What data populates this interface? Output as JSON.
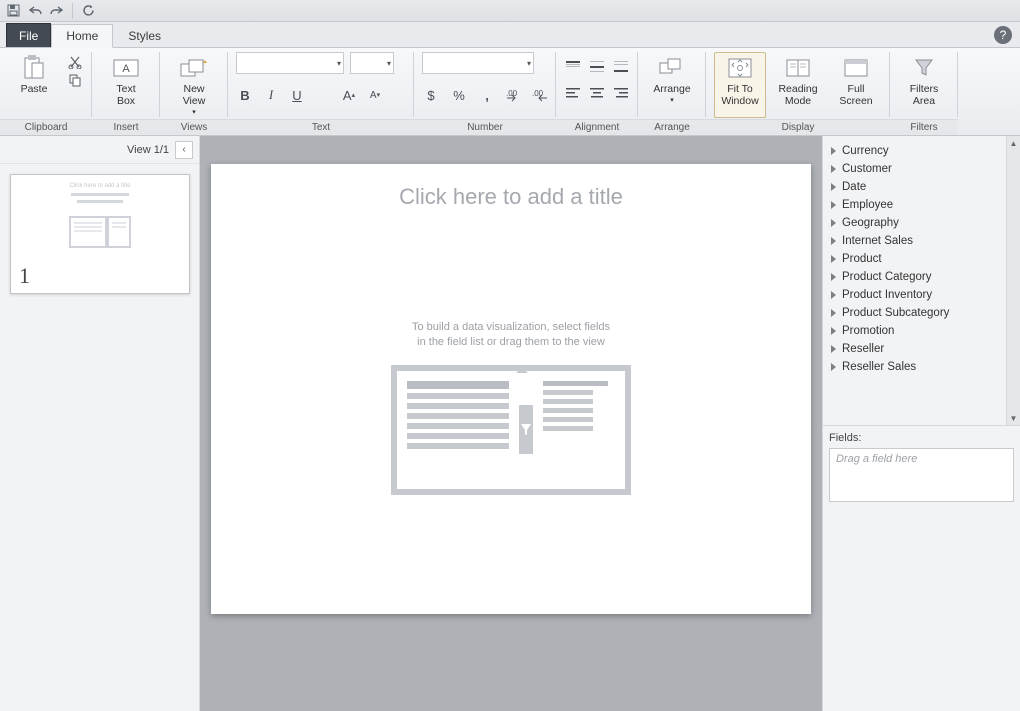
{
  "qat": {
    "save": "save-icon",
    "undo": "undo-icon",
    "redo": "redo-icon",
    "refresh": "refresh-icon"
  },
  "tabs": {
    "file": "File",
    "home": "Home",
    "styles": "Styles"
  },
  "ribbon": {
    "clipboard": {
      "paste": "Paste",
      "label": "Clipboard"
    },
    "insert": {
      "textbox": "Text\nBox",
      "newview": "New\nView",
      "label_insert": "Insert",
      "label_views": "Views"
    },
    "text": {
      "label": "Text"
    },
    "number": {
      "label": "Number"
    },
    "align": {
      "label": "Alignment"
    },
    "arrange": {
      "btn": "Arrange",
      "label": "Arrange"
    },
    "display": {
      "fit": "Fit To\nWindow",
      "reading": "Reading\nMode",
      "full": "Full\nScreen",
      "label": "Display"
    },
    "filters": {
      "btn": "Filters\nArea",
      "label": "Filters"
    }
  },
  "nav": {
    "view_label": "View 1/1",
    "page_number": "1"
  },
  "slide": {
    "title_placeholder": "Click here to add a title",
    "help_line1": "To build a data visualization, select fields",
    "help_line2": "in the field list or drag them to the view"
  },
  "fields": {
    "items": [
      "Currency",
      "Customer",
      "Date",
      "Employee",
      "Geography",
      "Internet Sales",
      "Product",
      "Product Category",
      "Product Inventory",
      "Product Subcategory",
      "Promotion",
      "Reseller",
      "Reseller Sales"
    ],
    "drop_label": "Fields:",
    "drop_hint": "Drag a field here"
  }
}
